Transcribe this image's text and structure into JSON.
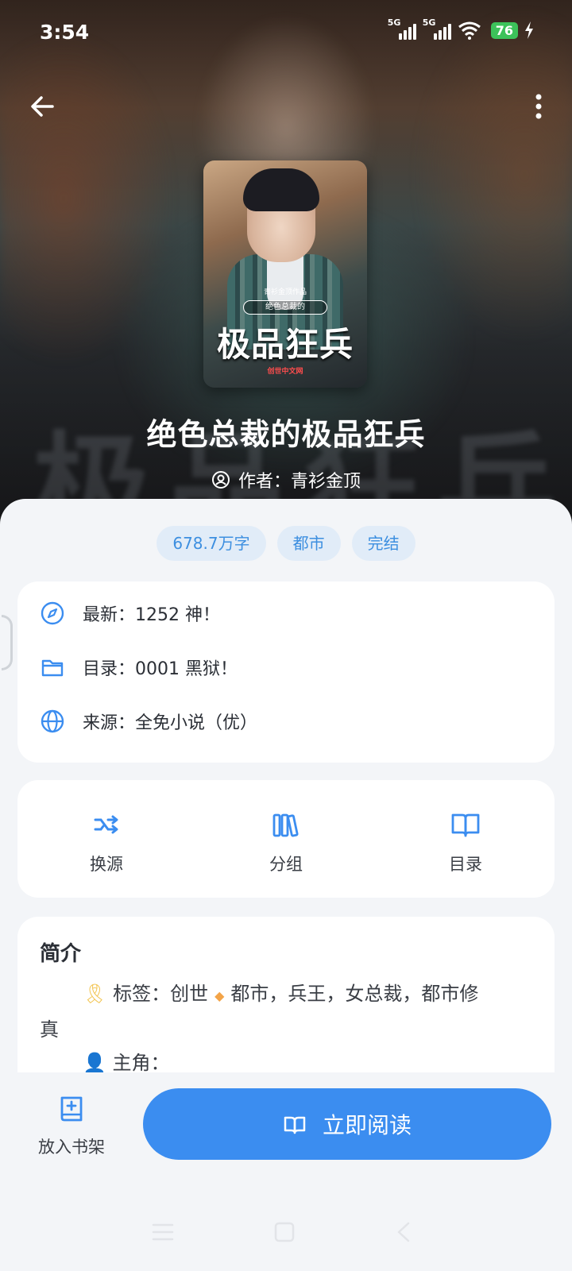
{
  "status_bar": {
    "time": "3:54",
    "network1": "5G",
    "network2": "5G",
    "battery": "76"
  },
  "book": {
    "title": "绝色总裁的极品狂兵",
    "author": "作者：青衫金顶",
    "cover": {
      "small_text": "青衫金顶作品",
      "subtitle": "绝色总裁的",
      "title": "极品狂兵",
      "publisher": "创世中文网"
    }
  },
  "tags": [
    "678.7万字",
    "都市",
    "完结"
  ],
  "info": {
    "latest": "最新：1252 神！",
    "catalog": "目录：0001 黑狱！",
    "source": "来源：全免小说（优）"
  },
  "actions": {
    "change_source": "换源",
    "group": "分组",
    "catalog": "目录"
  },
  "intro": {
    "heading": "简介",
    "tags_label": "标签：创世",
    "tags_value": "都市，兵王，女总裁，都市修",
    "tags_wrap": "真",
    "protagonist_label": "主角："
  },
  "bottom": {
    "add_shelf": "放入书架",
    "read_now": "立即阅读"
  },
  "colors": {
    "accent": "#3b8df0",
    "tag_bg": "#e1ecf8",
    "tag_text": "#3d8fe0"
  },
  "icons": [
    "back-icon",
    "more-icon",
    "user-icon",
    "compass-icon",
    "folder-icon",
    "globe-icon",
    "shuffle-icon",
    "books-icon",
    "book-open-icon",
    "add-book-icon",
    "read-icon"
  ]
}
